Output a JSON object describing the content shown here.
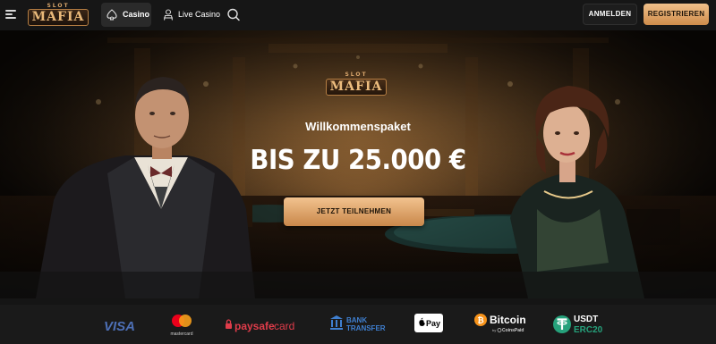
{
  "header": {
    "logo": {
      "top_word": "SLOT",
      "main_word": "MAFIA"
    },
    "tabs": [
      {
        "label": "Casino",
        "icon": "spade-icon",
        "active": true
      },
      {
        "label": "Live Casino",
        "icon": "dealer-icon",
        "active": false
      }
    ],
    "login_label": "ANMELDEN",
    "register_label": "REGISTRIEREN"
  },
  "hero": {
    "logo": {
      "top_word": "SLOT",
      "main_word": "MAFIA"
    },
    "subtitle": "Willkommenspaket",
    "title": "BIS ZU 25.000 €",
    "cta_label": "JETZT TEILNEHMEN"
  },
  "payments": {
    "visa": "VISA",
    "mastercard": "mastercard",
    "paysafecard_a": "paysafe",
    "paysafecard_b": "card",
    "bank_line1": "BANK",
    "bank_line2": "TRANSFER",
    "applepay": "Pay",
    "bitcoin": "Bitcoin",
    "bitcoin_sub_a": "by",
    "bitcoin_sub_b": "CoinsPaid",
    "usdt_line1": "USDT",
    "usdt_line2": "ERC20"
  },
  "colors": {
    "accent_gold": "#e2a96a",
    "background": "#121212"
  }
}
